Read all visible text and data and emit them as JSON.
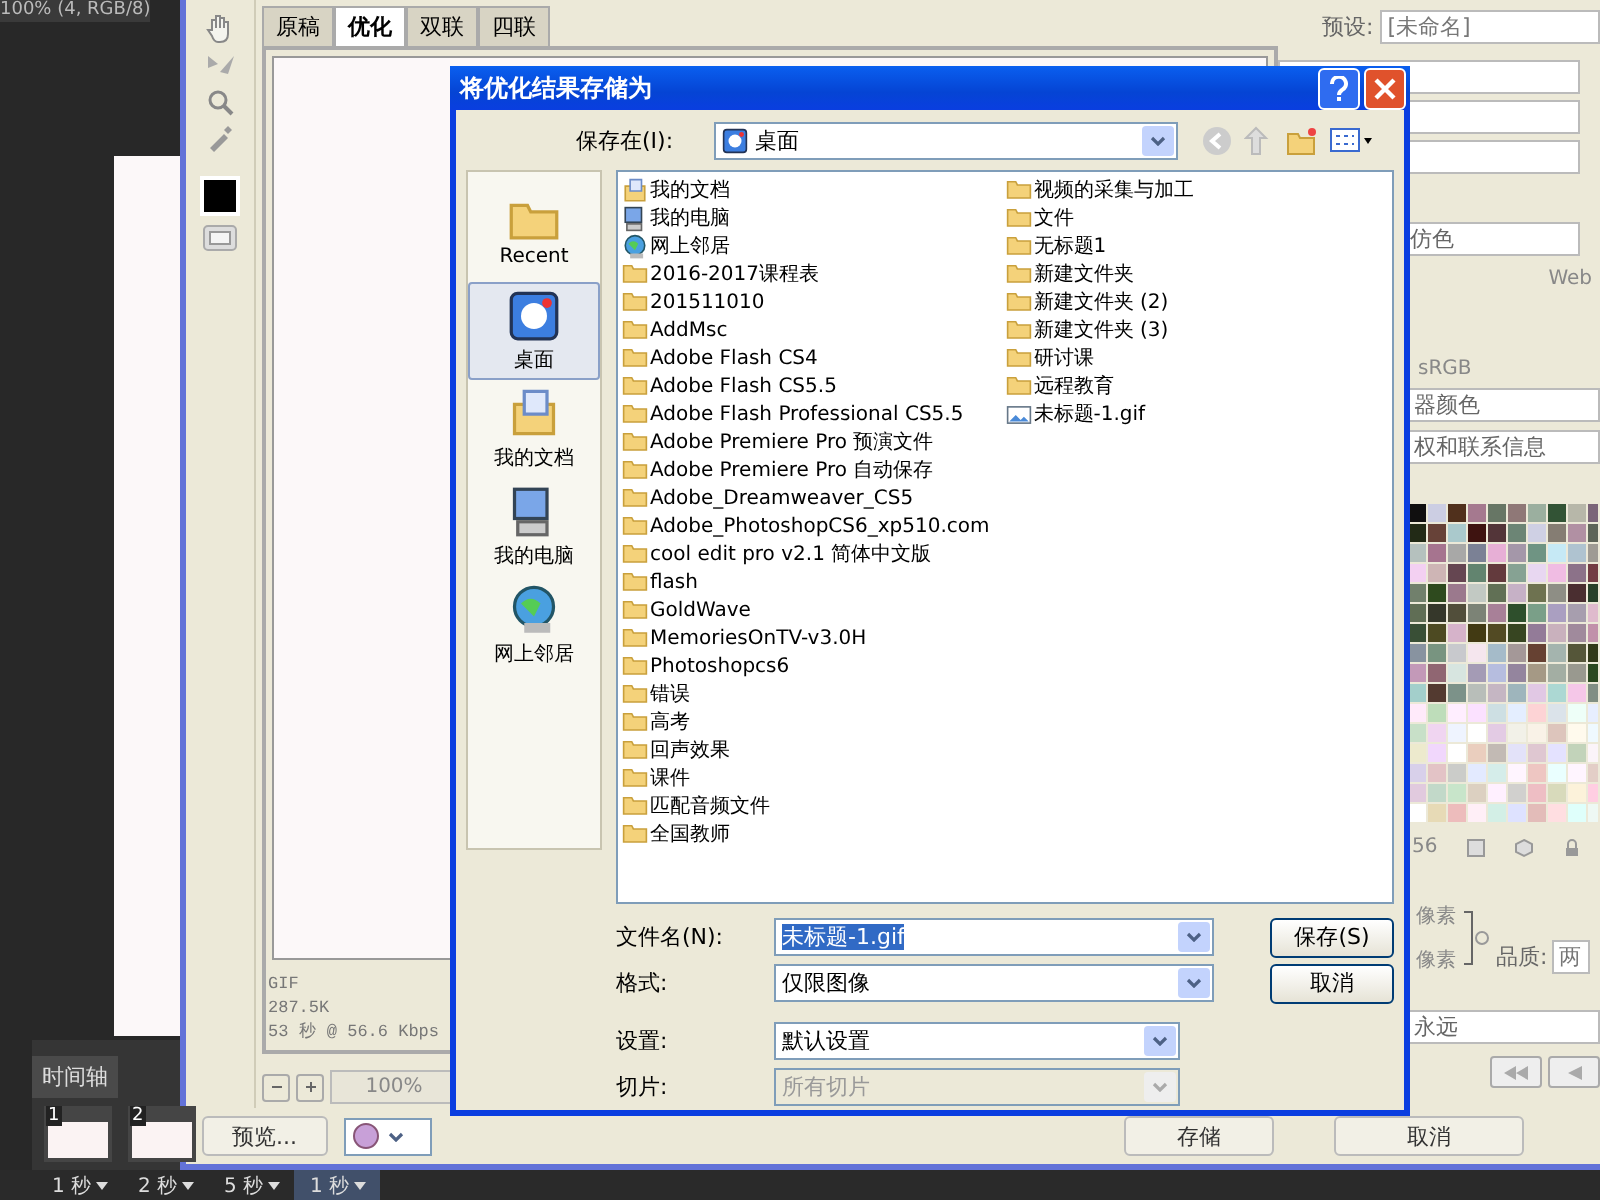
{
  "document_status": "100% (4, RGB/8)",
  "timeline": {
    "title": "时间轴",
    "frames": [
      {
        "number": "1",
        "delay": "1 秒",
        "selected": false
      },
      {
        "number": "2",
        "delay": "2 秒",
        "selected": false
      },
      {
        "delay": "5 秒",
        "selected": false
      },
      {
        "delay": "1 秒",
        "selected": true
      }
    ]
  },
  "save_for_web": {
    "tabs": [
      {
        "label": "原稿",
        "selected": false
      },
      {
        "label": "优化",
        "selected": true
      },
      {
        "label": "双联",
        "selected": false
      },
      {
        "label": "四联",
        "selected": false
      }
    ],
    "info": [
      "GIF",
      "287.5K",
      "53 秒 @ 56.6 Kbps"
    ],
    "zoom": "100%",
    "preview_button": "预览...",
    "save_button": "存储",
    "cancel_button": "取消",
    "settings": {
      "preset_label": "预设:",
      "preset_value": "[未命名]",
      "dither": "仿色",
      "web_label": "Web",
      "profile": "sRGB",
      "color_option": "器颜色",
      "metadata": "权和联系信息",
      "color_count": "56",
      "width_unit": "像素",
      "height_unit": "像素",
      "quality_label": "品质:",
      "quality_value": "两",
      "loop": "永远"
    }
  },
  "save_dialog": {
    "title": "将优化结果存储为",
    "save_in_label": "保存在(I):",
    "location": "桌面",
    "places": [
      {
        "label": "Recent",
        "kind": "recent",
        "selected": false
      },
      {
        "label": "桌面",
        "kind": "desktop",
        "selected": true
      },
      {
        "label": "我的文档",
        "kind": "documents",
        "selected": false
      },
      {
        "label": "我的电脑",
        "kind": "computer",
        "selected": false
      },
      {
        "label": "网上邻居",
        "kind": "network",
        "selected": false
      }
    ],
    "files": [
      {
        "name": "我的文档",
        "kind": "documents"
      },
      {
        "name": "我的电脑",
        "kind": "computer"
      },
      {
        "name": "网上邻居",
        "kind": "network"
      },
      {
        "name": "2016-2017课程表",
        "kind": "folder"
      },
      {
        "name": "201511010",
        "kind": "folder"
      },
      {
        "name": "AddMsc",
        "kind": "folder"
      },
      {
        "name": "Adobe Flash CS4",
        "kind": "folder"
      },
      {
        "name": "Adobe Flash CS5.5",
        "kind": "folder"
      },
      {
        "name": "Adobe Flash Professional CS5.5",
        "kind": "folder"
      },
      {
        "name": "Adobe Premiere Pro 预演文件",
        "kind": "folder"
      },
      {
        "name": "Adobe Premiere Pro 自动保存",
        "kind": "folder"
      },
      {
        "name": "Adobe_Dreamweaver_CS5",
        "kind": "folder"
      },
      {
        "name": "Adobe_PhotoshopCS6_xp510.com",
        "kind": "folder"
      },
      {
        "name": "cool edit pro v2.1 简体中文版",
        "kind": "folder"
      },
      {
        "name": "flash",
        "kind": "folder"
      },
      {
        "name": "GoldWave",
        "kind": "folder"
      },
      {
        "name": "MemoriesOnTV-v3.0H",
        "kind": "folder"
      },
      {
        "name": "Photoshopcs6",
        "kind": "folder"
      },
      {
        "name": "错误",
        "kind": "folder"
      },
      {
        "name": "高考",
        "kind": "folder"
      },
      {
        "name": "回声效果",
        "kind": "folder"
      },
      {
        "name": "课件",
        "kind": "folder"
      },
      {
        "name": "匹配音频文件",
        "kind": "folder"
      },
      {
        "name": "全国教师",
        "kind": "folder"
      },
      {
        "name": "视频的采集与加工",
        "kind": "folder"
      },
      {
        "name": "文件",
        "kind": "folder"
      },
      {
        "name": "无标题1",
        "kind": "folder"
      },
      {
        "name": "新建文件夹",
        "kind": "folder"
      },
      {
        "name": "新建文件夹 (2)",
        "kind": "folder"
      },
      {
        "name": "新建文件夹 (3)",
        "kind": "folder"
      },
      {
        "name": "研讨课",
        "kind": "folder"
      },
      {
        "name": "远程教育",
        "kind": "folder"
      },
      {
        "name": "未标题-1.gif",
        "kind": "image"
      }
    ],
    "file_name_label": "文件名(N):",
    "file_name": "未标题-1.gif",
    "file_name_selected": true,
    "format_label": "格式:",
    "format": "仅限图像",
    "settings_label": "设置:",
    "settings": "默认设置",
    "slices_label": "切片:",
    "slices": "所有切片",
    "slices_disabled": true,
    "save_button": "保存(S)",
    "cancel_button": "取消"
  }
}
